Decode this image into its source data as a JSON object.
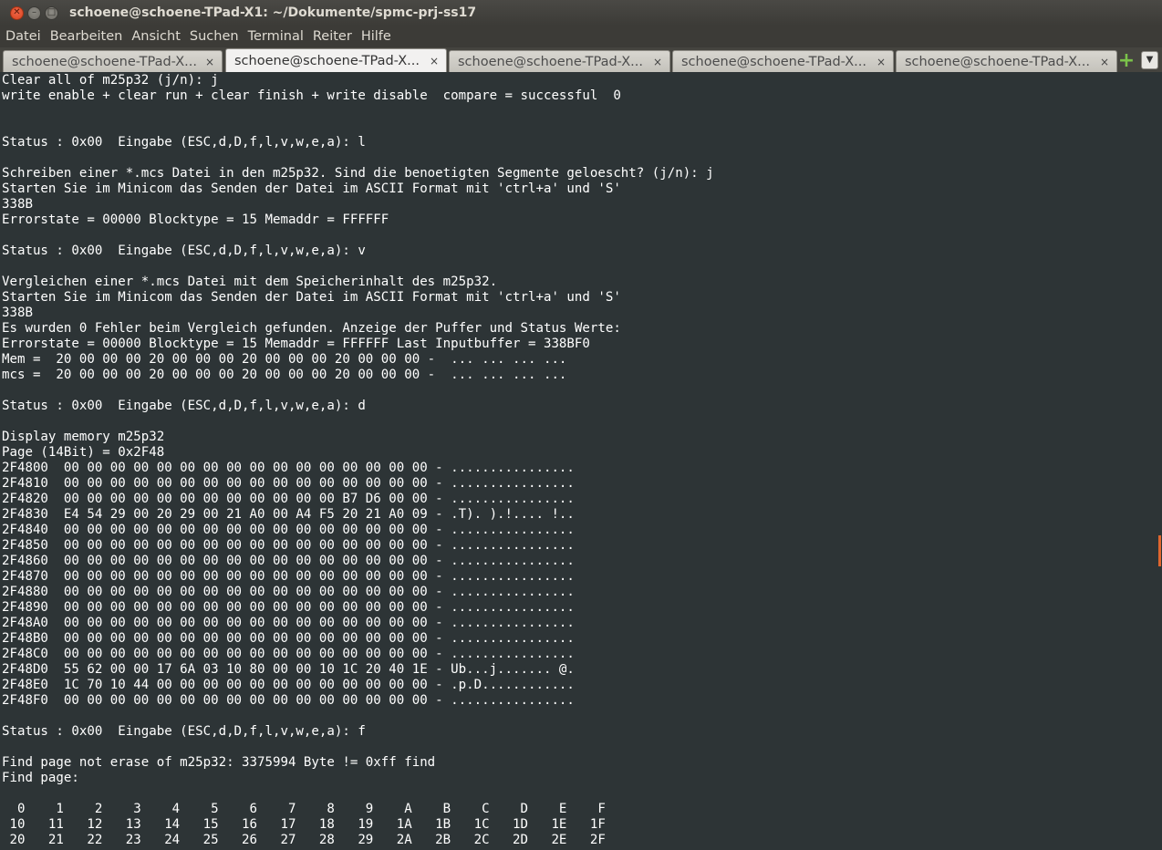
{
  "window": {
    "title": "schoene@schoene-TPad-X1: ~/Dokumente/spmc-prj-ss17",
    "close_glyph": "✕",
    "min_glyph": "–",
    "max_glyph": "□"
  },
  "menu": [
    "Datei",
    "Bearbeiten",
    "Ansicht",
    "Suchen",
    "Terminal",
    "Reiter",
    "Hilfe"
  ],
  "tabs": [
    {
      "label": "schoene@schoene-TPad-X...",
      "close": "×",
      "active": false
    },
    {
      "label": "schoene@schoene-TPad-X...",
      "close": "×",
      "active": true
    },
    {
      "label": "schoene@schoene-TPad-X...",
      "close": "×",
      "active": false
    },
    {
      "label": "schoene@schoene-TPad-X...",
      "close": "×",
      "active": false
    },
    {
      "label": "schoene@schoene-TPad-X...",
      "close": "×",
      "active": false
    }
  ],
  "tab_controls": {
    "new_tab_glyph": "+",
    "tab_menu_glyph": "▼"
  },
  "terminal": {
    "background": "#2d3436",
    "foreground": "#ffffff",
    "lines": [
      "Clear all of m25p32 (j/n): j",
      "write enable + clear run + clear finish + write disable  compare = successful  0",
      "",
      "",
      "Status : 0x00  Eingabe (ESC,d,D,f,l,v,w,e,a): l",
      "",
      "Schreiben einer *.mcs Datei in den m25p32. Sind die benoetigten Segmente geloescht? (j/n): j",
      "Starten Sie im Minicom das Senden der Datei im ASCII Format mit 'ctrl+a' und 'S'",
      "338B",
      "Errorstate = 00000 Blocktype = 15 Memaddr = FFFFFF",
      "",
      "Status : 0x00  Eingabe (ESC,d,D,f,l,v,w,e,a): v",
      "",
      "Vergleichen einer *.mcs Datei mit dem Speicherinhalt des m25p32.",
      "Starten Sie im Minicom das Senden der Datei im ASCII Format mit 'ctrl+a' und 'S'",
      "338B",
      "Es wurden 0 Fehler beim Vergleich gefunden. Anzeige der Puffer und Status Werte:",
      "Errorstate = 00000 Blocktype = 15 Memaddr = FFFFFF Last Inputbuffer = 338BF0",
      "Mem =  20 00 00 00 20 00 00 00 20 00 00 00 20 00 00 00 -  ... ... ... ...",
      "mcs =  20 00 00 00 20 00 00 00 20 00 00 00 20 00 00 00 -  ... ... ... ...",
      "",
      "Status : 0x00  Eingabe (ESC,d,D,f,l,v,w,e,a): d",
      "",
      "Display memory m25p32",
      "Page (14Bit) = 0x2F48",
      "2F4800  00 00 00 00 00 00 00 00 00 00 00 00 00 00 00 00 - ................",
      "2F4810  00 00 00 00 00 00 00 00 00 00 00 00 00 00 00 00 - ................",
      "2F4820  00 00 00 00 00 00 00 00 00 00 00 00 B7 D6 00 00 - ................",
      "2F4830  E4 54 29 00 20 29 00 21 A0 00 A4 F5 20 21 A0 09 - .T). ).!.... !..",
      "2F4840  00 00 00 00 00 00 00 00 00 00 00 00 00 00 00 00 - ................",
      "2F4850  00 00 00 00 00 00 00 00 00 00 00 00 00 00 00 00 - ................",
      "2F4860  00 00 00 00 00 00 00 00 00 00 00 00 00 00 00 00 - ................",
      "2F4870  00 00 00 00 00 00 00 00 00 00 00 00 00 00 00 00 - ................",
      "2F4880  00 00 00 00 00 00 00 00 00 00 00 00 00 00 00 00 - ................",
      "2F4890  00 00 00 00 00 00 00 00 00 00 00 00 00 00 00 00 - ................",
      "2F48A0  00 00 00 00 00 00 00 00 00 00 00 00 00 00 00 00 - ................",
      "2F48B0  00 00 00 00 00 00 00 00 00 00 00 00 00 00 00 00 - ................",
      "2F48C0  00 00 00 00 00 00 00 00 00 00 00 00 00 00 00 00 - ................",
      "2F48D0  55 62 00 00 17 6A 03 10 80 00 00 10 1C 20 40 1E - Ub...j....... @.",
      "2F48E0  1C 70 10 44 00 00 00 00 00 00 00 00 00 00 00 00 - .p.D............",
      "2F48F0  00 00 00 00 00 00 00 00 00 00 00 00 00 00 00 00 - ................",
      "",
      "Status : 0x00  Eingabe (ESC,d,D,f,l,v,w,e,a): f",
      "",
      "Find page not erase of m25p32: 3375994 Byte != 0xff find",
      "Find page:",
      "",
      "  0    1    2    3    4    5    6    7    8    9    A    B    C    D    E    F",
      " 10   11   12   13   14   15   16   17   18   19   1A   1B   1C   1D   1E   1F",
      " 20   21   22   23   24   25   26   27   28   29   2A   2B   2C   2D   2E   2F"
    ]
  },
  "scrollbar": {
    "thumb_color": "#e0662e"
  }
}
